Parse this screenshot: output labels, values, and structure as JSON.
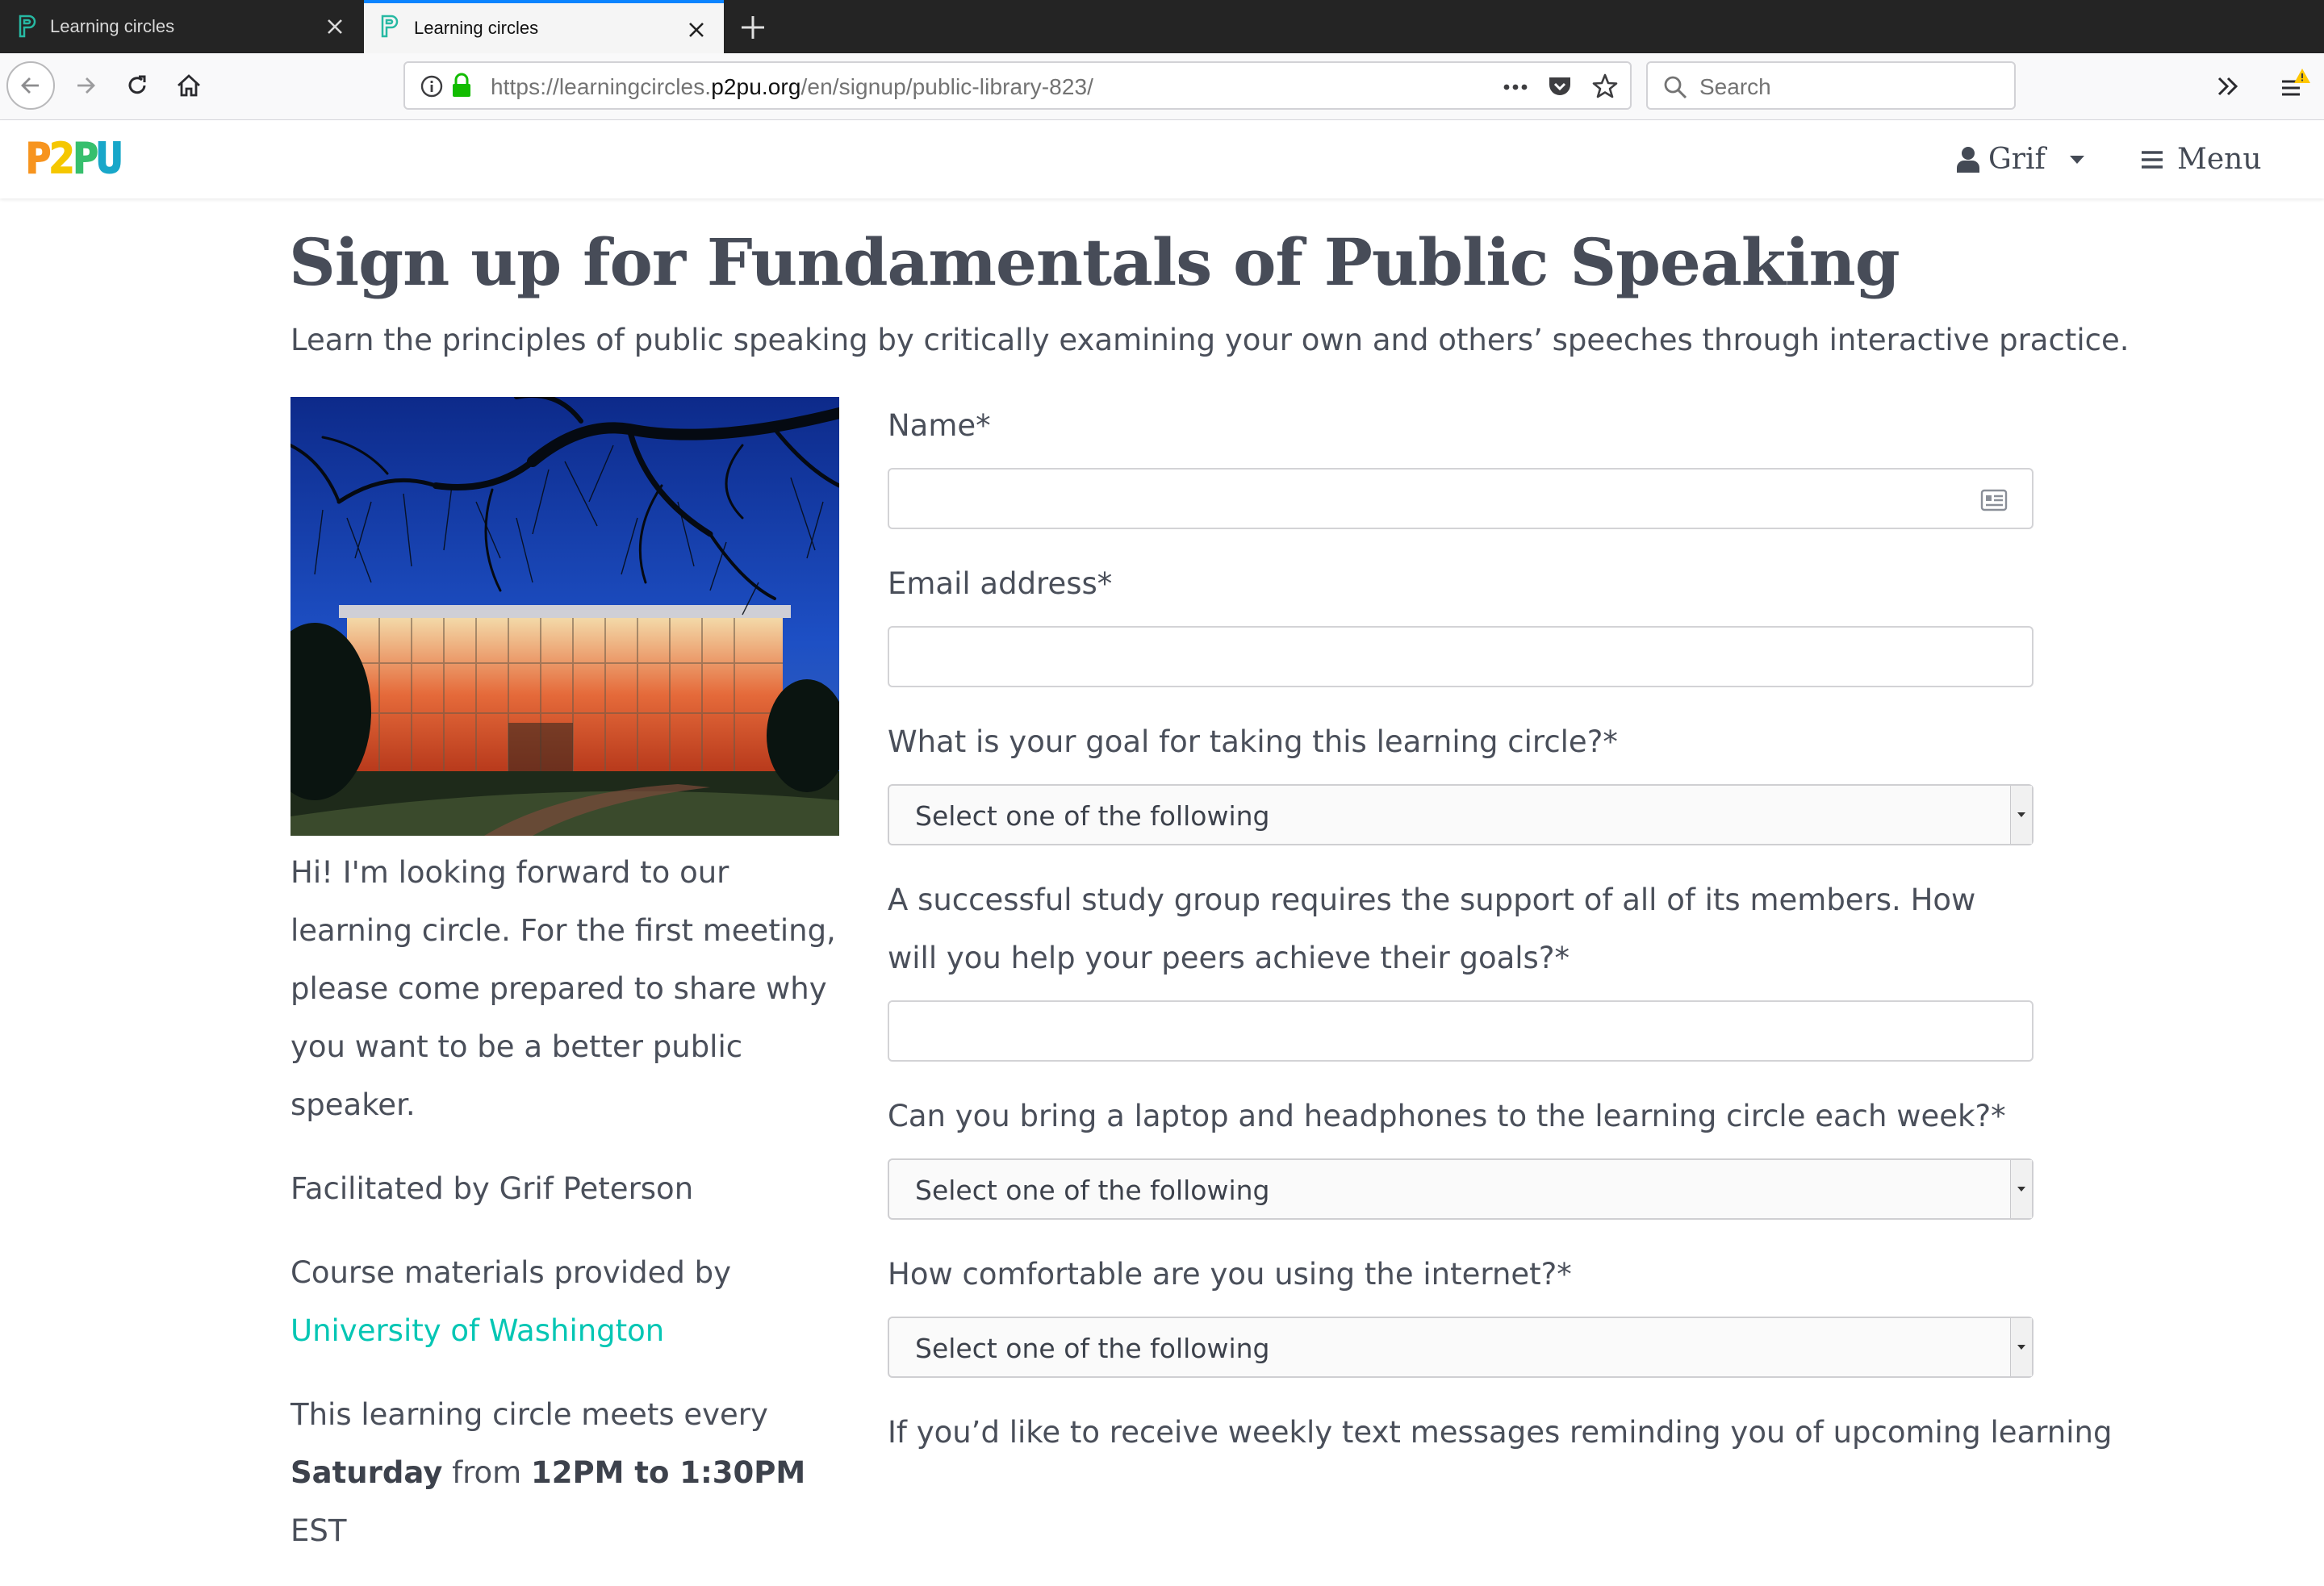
{
  "browser": {
    "tabs": [
      {
        "title": "Learning circles",
        "active": false
      },
      {
        "title": "Learning circles",
        "active": true
      }
    ],
    "url": {
      "prefix": "https://learningcircles.",
      "host": "p2pu.org",
      "path": "/en/signup/public-library-823/"
    },
    "search_placeholder": "Search"
  },
  "site": {
    "logo_letters": [
      "P",
      "2",
      "P",
      "U"
    ],
    "logo_colors": [
      "#f7941e",
      "#f5c700",
      "#36bf6d",
      "#18a7c9"
    ],
    "user_name": "Grif",
    "menu_label": "Menu"
  },
  "page": {
    "title": "Sign up for Fundamentals of Public Speaking",
    "subtitle": "Learn the principles of public speaking by critically examining your own and others’ speeches through interactive practice."
  },
  "sidebar": {
    "welcome_text": "Hi! I'm looking forward to our learning circle. For the first meeting, please come prepared to share why you want to be a better public speaker.",
    "facilitated_by": "Facilitated by Grif Peterson",
    "materials_prefix": "Course materials provided by ",
    "materials_link": "University of Washington",
    "meets_prefix": "This learning circle meets every",
    "meets_day": "Saturday",
    "meets_from": " from ",
    "meets_time": "12PM to 1:30PM",
    "meets_tz": " EST"
  },
  "form": {
    "name_label": "Name*",
    "email_label": "Email address*",
    "goal_label": "What is your goal for taking this learning circle?*",
    "goal_value": "Select one of the following",
    "support_label": "A successful study group requires the support of all of its members. How will you help your peers achieve their goals?*",
    "laptop_label": "Can you bring a laptop and headphones to the learning circle each week?*",
    "laptop_value": "Select one of the following",
    "internet_label": "How comfortable are you using the internet?*",
    "internet_value": "Select one of the following",
    "sms_label": "If you’d like to receive weekly text messages reminding you of upcoming learning"
  },
  "colors": {
    "link": "#05c6b4",
    "tab_accent": "#0a84ff",
    "text": "#4a4f5a"
  }
}
